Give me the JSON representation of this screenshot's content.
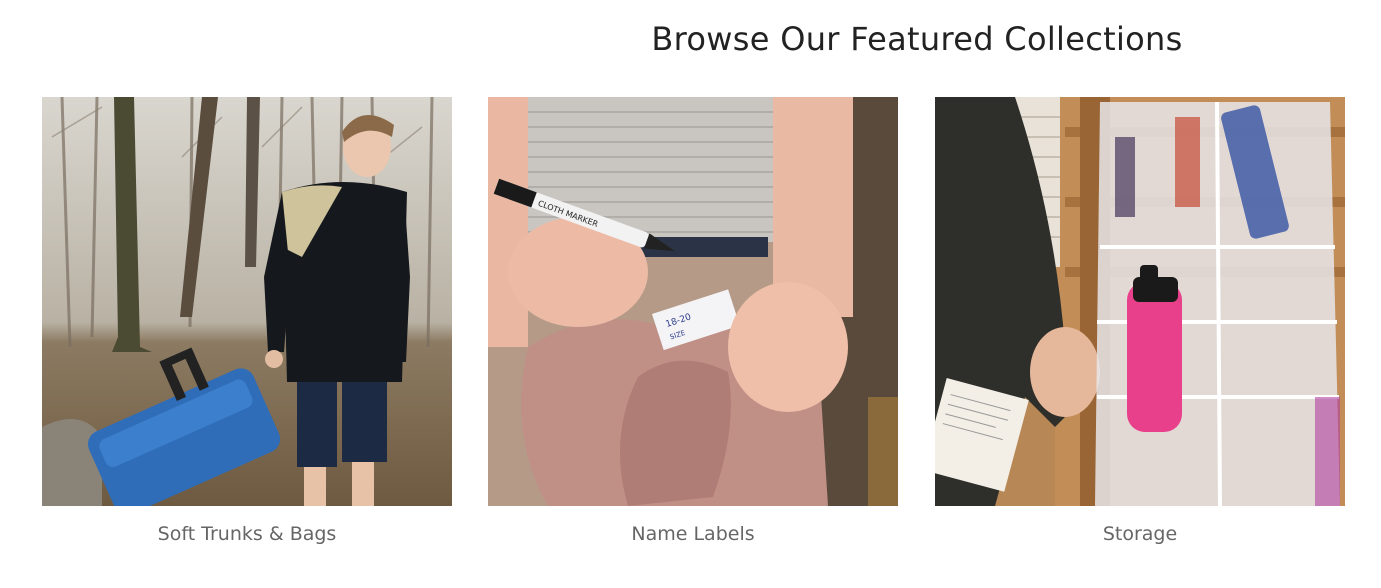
{
  "section": {
    "title": "Browse Our Featured Collections"
  },
  "collections": [
    {
      "label": "Soft Trunks & Bags"
    },
    {
      "label": "Name Labels"
    },
    {
      "label": "Storage"
    }
  ],
  "colors": {
    "title": "#222222",
    "caption": "#666666",
    "background": "#ffffff"
  }
}
